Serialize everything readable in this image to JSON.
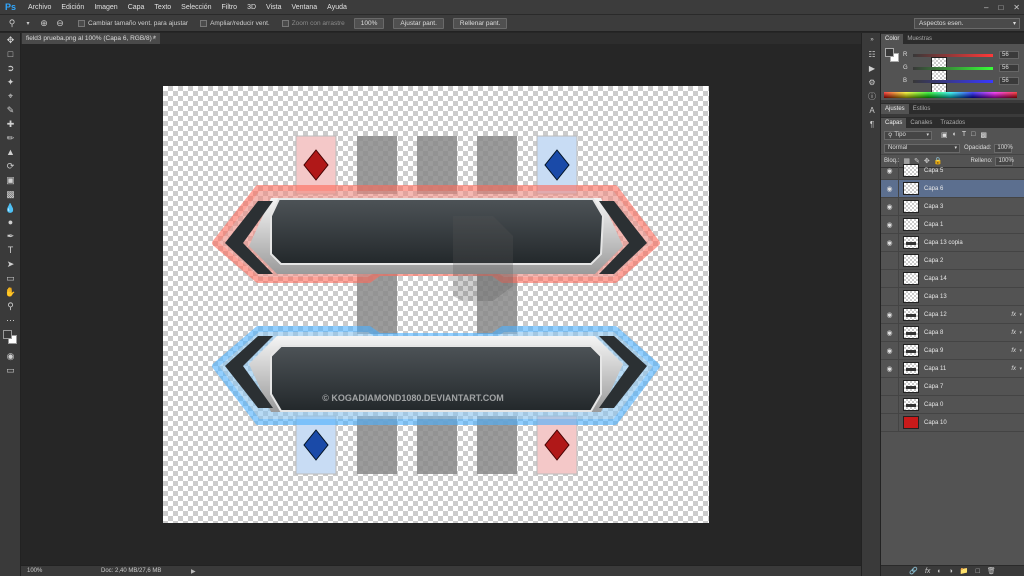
{
  "app": {
    "logo": "Ps",
    "menu": [
      "Archivo",
      "Edición",
      "Imagen",
      "Capa",
      "Texto",
      "Selección",
      "Filtro",
      "3D",
      "Vista",
      "Ventana",
      "Ayuda"
    ]
  },
  "options": {
    "resize_windows": "Cambiar tamaño vent. para ajustar",
    "zoom_all": "Ampliar/reducir vent.",
    "scrubby_zoom": "Zoom con arrastre",
    "zoom_100": "100%",
    "fit_screen": "Ajustar pant.",
    "fill_screen": "Rellenar pant.",
    "workspace": "Aspectos esen."
  },
  "document": {
    "tab_title": "field3 prueba.png al 100% (Capa 6, RGB/8) *",
    "watermark": "© KOGADIAMOND1080.DEVIANTART.COM"
  },
  "status": {
    "zoom": "100%",
    "doc_info": "Doc: 2,40 MB/27,6 MB"
  },
  "color_panel": {
    "tabs": [
      "Color",
      "Muestras"
    ],
    "fg": "#383838",
    "bg": "#ffffff",
    "channels": [
      {
        "label": "R",
        "value": "56"
      },
      {
        "label": "G",
        "value": "56"
      },
      {
        "label": "B",
        "value": "56"
      }
    ]
  },
  "adjust_tabs": [
    "Ajustes",
    "Estilos"
  ],
  "layers_panel": {
    "tabs": [
      "Capas",
      "Canales",
      "Trazados"
    ],
    "filter": "Tipo",
    "blend_mode": "Normal",
    "opacity_label": "Opacidad:",
    "opacity": "100%",
    "lock_label": "Bloq.:",
    "fill_label": "Relleno:",
    "fill": "100%",
    "layers": [
      {
        "name": "Capa 5",
        "visible": true,
        "selected": false,
        "fx": false
      },
      {
        "name": "Capa 6",
        "visible": true,
        "selected": true,
        "fx": false
      },
      {
        "name": "Capa 3",
        "visible": true,
        "selected": false,
        "fx": false
      },
      {
        "name": "Capa 1",
        "visible": true,
        "selected": false,
        "fx": false
      },
      {
        "name": "Capa 13 copia",
        "visible": true,
        "selected": false,
        "fx": false
      },
      {
        "name": "Capa 2",
        "visible": false,
        "selected": false,
        "fx": false
      },
      {
        "name": "Capa 14",
        "visible": false,
        "selected": false,
        "fx": false
      },
      {
        "name": "Capa 13",
        "visible": false,
        "selected": false,
        "fx": false
      },
      {
        "name": "Capa 12",
        "visible": true,
        "selected": false,
        "fx": true
      },
      {
        "name": "Capa 8",
        "visible": true,
        "selected": false,
        "fx": true
      },
      {
        "name": "Capa 9",
        "visible": true,
        "selected": false,
        "fx": true
      },
      {
        "name": "Capa 11",
        "visible": true,
        "selected": false,
        "fx": true
      },
      {
        "name": "Capa 7",
        "visible": false,
        "selected": false,
        "fx": false
      },
      {
        "name": "Capa 0",
        "visible": false,
        "selected": false,
        "fx": false
      },
      {
        "name": "Capa 10",
        "visible": false,
        "selected": false,
        "fx": false
      }
    ]
  },
  "fx_label": "fx",
  "colors": {
    "accent_red": "#e8453c",
    "accent_blue": "#3aa0f0",
    "selected_row": "#5c6f8f",
    "red_layer": "#c81a1a"
  }
}
